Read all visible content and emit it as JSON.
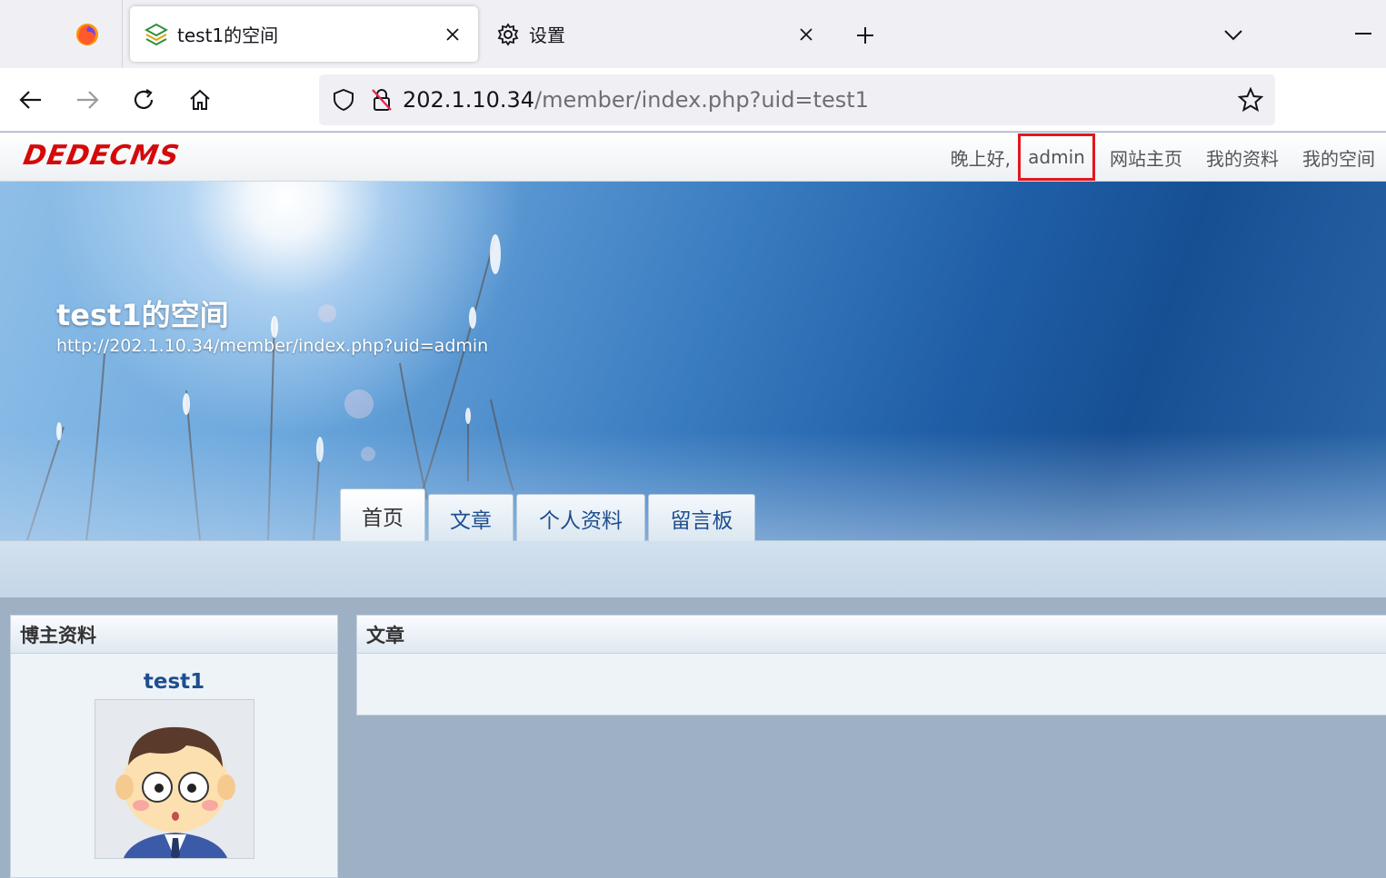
{
  "browser": {
    "tabs": [
      {
        "title": "test1的空间",
        "active": true
      },
      {
        "title": "设置",
        "active": false
      }
    ],
    "url_host": "202.1.10.34",
    "url_path": "/member/index.php?uid=test1"
  },
  "site": {
    "logo_text": "DEDECMS",
    "greeting": "晚上好,",
    "username_link": "admin",
    "links": [
      "网站主页",
      "我的资料",
      "我的空间"
    ],
    "accent_color": "#e3161f"
  },
  "banner": {
    "space_title": "test1的空间",
    "space_url": "http://202.1.10.34/member/index.php?uid=admin"
  },
  "nav_tabs": [
    {
      "label": "首页",
      "active": true
    },
    {
      "label": "文章",
      "active": false
    },
    {
      "label": "个人资料",
      "active": false
    },
    {
      "label": "留言板",
      "active": false
    }
  ],
  "left_panel": {
    "title": "博主资料",
    "username": "test1"
  },
  "right_panel": {
    "title": "文章"
  }
}
